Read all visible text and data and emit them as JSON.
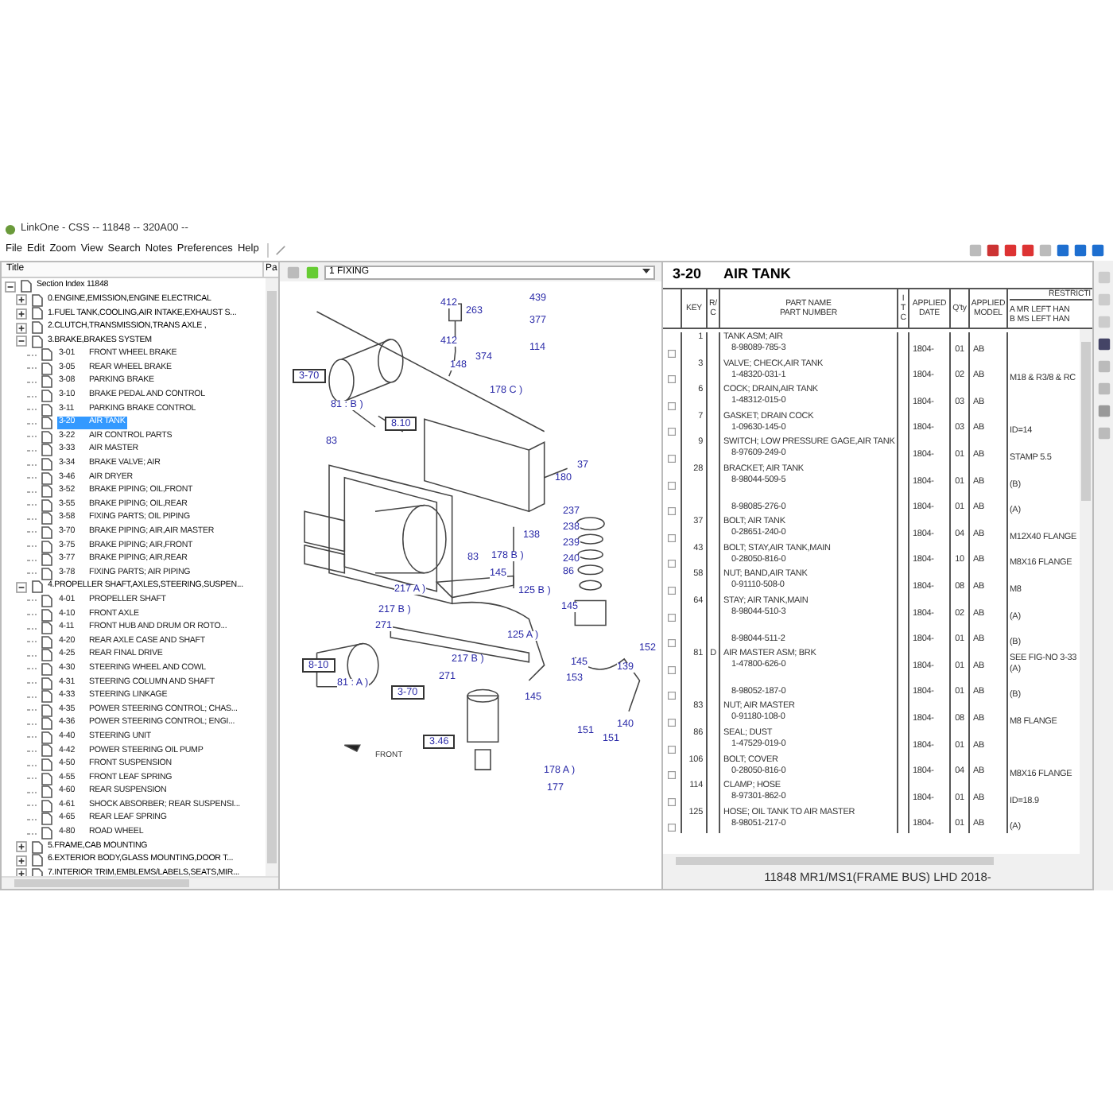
{
  "window": {
    "title": "LinkOne - CSS -- 11848 -- 320A00 --"
  },
  "menu": [
    "File",
    "Edit",
    "Zoom",
    "View",
    "Search",
    "Notes",
    "Preferences",
    "Help"
  ],
  "tree": {
    "columns": [
      "Title",
      "Pa"
    ],
    "items": [
      {
        "kind": "group",
        "label": "Section Index 11848",
        "expanded": true,
        "children": [
          {
            "kind": "group",
            "label": "0.ENGINE,EMISSION,ENGINE ELECTRICAL",
            "expanded": false
          },
          {
            "kind": "group",
            "label": "1.FUEL TANK,COOLING,AIR INTAKE,EXHAUST S...",
            "expanded": false
          },
          {
            "kind": "group",
            "label": "2.CLUTCH,TRANSMISSION,TRANS AXLE ,",
            "expanded": false
          },
          {
            "kind": "group",
            "label": "3.BRAKE,BRAKES SYSTEM",
            "expanded": true,
            "children": [
              {
                "kind": "page",
                "code": "3-01",
                "label": "FRONT WHEEL BRAKE",
                "selected": false
              },
              {
                "kind": "page",
                "code": "3-05",
                "label": "REAR WHEEL BRAKE",
                "selected": false
              },
              {
                "kind": "page",
                "code": "3-08",
                "label": "PARKING BRAKE",
                "selected": false
              },
              {
                "kind": "page",
                "code": "3-10",
                "label": "BRAKE PEDAL AND CONTROL",
                "selected": false
              },
              {
                "kind": "page",
                "code": "3-11",
                "label": "PARKING BRAKE CONTROL",
                "selected": false
              },
              {
                "kind": "page",
                "code": "3-20",
                "label": "AIR TANK",
                "selected": true
              },
              {
                "kind": "page",
                "code": "3-22",
                "label": "AIR CONTROL PARTS",
                "selected": false
              },
              {
                "kind": "page",
                "code": "3-33",
                "label": "AIR MASTER",
                "selected": false
              },
              {
                "kind": "page",
                "code": "3-34",
                "label": "BRAKE VALVE; AIR",
                "selected": false
              },
              {
                "kind": "page",
                "code": "3-46",
                "label": "AIR DRYER",
                "selected": false
              },
              {
                "kind": "page",
                "code": "3-52",
                "label": "BRAKE PIPING; OIL,FRONT",
                "selected": false
              },
              {
                "kind": "page",
                "code": "3-55",
                "label": "BRAKE PIPING; OIL,REAR",
                "selected": false
              },
              {
                "kind": "page",
                "code": "3-58",
                "label": "FIXING PARTS; OIL PIPING",
                "selected": false
              },
              {
                "kind": "page",
                "code": "3-70",
                "label": "BRAKE PIPING; AIR,AIR MASTER",
                "selected": false
              },
              {
                "kind": "page",
                "code": "3-75",
                "label": "BRAKE PIPING; AIR,FRONT",
                "selected": false
              },
              {
                "kind": "page",
                "code": "3-77",
                "label": "BRAKE PIPING; AIR,REAR",
                "selected": false
              },
              {
                "kind": "page",
                "code": "3-78",
                "label": "FIXING PARTS; AIR PIPING",
                "selected": false
              }
            ]
          },
          {
            "kind": "group",
            "label": "4.PROPELLER SHAFT,AXLES,STEERING,SUSPEN...",
            "expanded": true,
            "children": [
              {
                "kind": "page",
                "code": "4-01",
                "label": "PROPELLER SHAFT",
                "selected": false
              },
              {
                "kind": "page",
                "code": "4-10",
                "label": "FRONT AXLE",
                "selected": false
              },
              {
                "kind": "page",
                "code": "4-11",
                "label": "FRONT HUB AND DRUM OR ROTO...",
                "selected": false
              },
              {
                "kind": "page",
                "code": "4-20",
                "label": "REAR AXLE CASE AND SHAFT",
                "selected": false
              },
              {
                "kind": "page",
                "code": "4-25",
                "label": "REAR FINAL DRIVE",
                "selected": false
              },
              {
                "kind": "page",
                "code": "4-30",
                "label": "STEERING WHEEL AND COWL",
                "selected": false
              },
              {
                "kind": "page",
                "code": "4-31",
                "label": "STEERING COLUMN AND SHAFT",
                "selected": false
              },
              {
                "kind": "page",
                "code": "4-33",
                "label": "STEERING LINKAGE",
                "selected": false
              },
              {
                "kind": "page",
                "code": "4-35",
                "label": "POWER STEERING CONTROL; CHAS...",
                "selected": false
              },
              {
                "kind": "page",
                "code": "4-36",
                "label": "POWER STEERING CONTROL; ENGI...",
                "selected": false
              },
              {
                "kind": "page",
                "code": "4-40",
                "label": "STEERING UNIT",
                "selected": false
              },
              {
                "kind": "page",
                "code": "4-42",
                "label": "POWER STEERING OIL PUMP",
                "selected": false
              },
              {
                "kind": "page",
                "code": "4-50",
                "label": "FRONT SUSPENSION",
                "selected": false
              },
              {
                "kind": "page",
                "code": "4-55",
                "label": "FRONT LEAF SPRING",
                "selected": false
              },
              {
                "kind": "page",
                "code": "4-60",
                "label": "REAR SUSPENSION",
                "selected": false
              },
              {
                "kind": "page",
                "code": "4-61",
                "label": "SHOCK ABSORBER; REAR SUSPENSI...",
                "selected": false
              },
              {
                "kind": "page",
                "code": "4-65",
                "label": "REAR LEAF SPRING",
                "selected": false
              },
              {
                "kind": "page",
                "code": "4-80",
                "label": "ROAD WHEEL",
                "selected": false
              }
            ]
          },
          {
            "kind": "group",
            "label": "5.FRAME,CAB MOUNTING",
            "expanded": false
          },
          {
            "kind": "group",
            "label": "6.EXTERIOR BODY,GLASS MOUNTING,DOOR T...",
            "expanded": false
          },
          {
            "kind": "group",
            "label": "7.INTERIOR TRIM,EMBLEMS/LABELS,SEATS,MIR...",
            "expanded": false
          }
        ]
      }
    ]
  },
  "diagram": {
    "selector": "1 FIXING",
    "callouts": [
      {
        "kind": "num",
        "text": "412"
      },
      {
        "kind": "num",
        "text": "263"
      },
      {
        "kind": "num",
        "text": "439"
      },
      {
        "kind": "num",
        "text": "377"
      },
      {
        "kind": "num",
        "text": "412"
      },
      {
        "kind": "num",
        "text": "374"
      },
      {
        "kind": "num",
        "text": "114"
      },
      {
        "kind": "num",
        "text": "148"
      },
      {
        "kind": "num",
        "text": "178 C )"
      },
      {
        "kind": "ref",
        "text": "3-70"
      },
      {
        "kind": "num",
        "text": "81 : B )"
      },
      {
        "kind": "ref",
        "text": "8.10"
      },
      {
        "kind": "num",
        "text": "83"
      },
      {
        "kind": "num",
        "text": "180"
      },
      {
        "kind": "num",
        "text": "37"
      },
      {
        "kind": "num",
        "text": "237"
      },
      {
        "kind": "num",
        "text": "238"
      },
      {
        "kind": "num",
        "text": "138"
      },
      {
        "kind": "num",
        "text": "239"
      },
      {
        "kind": "num",
        "text": "240"
      },
      {
        "kind": "num",
        "text": "86"
      },
      {
        "kind": "num",
        "text": "83"
      },
      {
        "kind": "num",
        "text": "178 B )"
      },
      {
        "kind": "num",
        "text": "145"
      },
      {
        "kind": "num",
        "text": "217 A )"
      },
      {
        "kind": "num",
        "text": "125 B )"
      },
      {
        "kind": "num",
        "text": "217 B )"
      },
      {
        "kind": "num",
        "text": "145"
      },
      {
        "kind": "num",
        "text": "271"
      },
      {
        "kind": "num",
        "text": "125 A )"
      },
      {
        "kind": "num",
        "text": "145"
      },
      {
        "kind": "num",
        "text": "152"
      },
      {
        "kind": "ref",
        "text": "8-10"
      },
      {
        "kind": "num",
        "text": "217 B )"
      },
      {
        "kind": "num",
        "text": "271"
      },
      {
        "kind": "num",
        "text": "153"
      },
      {
        "kind": "num",
        "text": "139"
      },
      {
        "kind": "num",
        "text": "81 : A )"
      },
      {
        "kind": "ref",
        "text": "3-70"
      },
      {
        "kind": "num",
        "text": "145"
      },
      {
        "kind": "num",
        "text": "140"
      },
      {
        "kind": "num",
        "text": "151"
      },
      {
        "kind": "num",
        "text": "151"
      },
      {
        "kind": "ref",
        "text": "3.46"
      },
      {
        "kind": "note",
        "text": "FRONT"
      },
      {
        "kind": "num",
        "text": "178 A )"
      },
      {
        "kind": "num",
        "text": "177"
      }
    ]
  },
  "parts": {
    "code": "3-20",
    "title": "AIR TANK",
    "header": {
      "key": "KEY",
      "rc": "R/C",
      "part": [
        "PART NAME",
        "PART NUMBER"
      ],
      "itc": "ITC",
      "date": [
        "APPLIED",
        "DATE"
      ],
      "qty": "Q'ty",
      "model": [
        "APPLIED",
        "MODEL"
      ],
      "restriction": "RESTRICTI",
      "restriction_lines": [
        "A MR LEFT HAN",
        "B MS LEFT HAN"
      ]
    },
    "rows": [
      {
        "checked": false,
        "key": "1",
        "name": "TANK ASM; AIR",
        "number": "8-98089-785-3",
        "date": "1804-",
        "qty": "01",
        "model": "AB"
      },
      {
        "checked": false,
        "key": "3",
        "name": "VALVE; CHECK,AIR TANK",
        "number": "1-48320-031-1",
        "date": "1804-",
        "qty": "02",
        "model": "AB",
        "restriction": [
          "M18 & R3/8 & RC"
        ]
      },
      {
        "checked": false,
        "key": "6",
        "name": "COCK; DRAIN,AIR TANK",
        "number": "1-48312-015-0",
        "date": "1804-",
        "qty": "03",
        "model": "AB"
      },
      {
        "checked": false,
        "key": "7",
        "name": "GASKET; DRAIN COCK",
        "number": "1-09630-145-0",
        "date": "1804-",
        "qty": "03",
        "model": "AB",
        "restriction": [
          "ID=14"
        ]
      },
      {
        "checked": false,
        "key": "9",
        "name": "SWITCH; LOW PRESSURE GAGE,AIR TANK",
        "number": "8-97609-249-0",
        "date": "1804-",
        "qty": "01",
        "model": "AB",
        "restriction": [
          "STAMP 5.5"
        ]
      },
      {
        "checked": false,
        "key": "28",
        "name": "BRACKET; AIR TANK",
        "number": "8-98044-509-5",
        "date": "1804-",
        "qty": "01",
        "model": "AB",
        "restriction": [
          "(B)"
        ]
      },
      {
        "checked": false,
        "number": "8-98085-276-0",
        "date": "1804-",
        "qty": "01",
        "model": "AB",
        "restriction": [
          "(A)"
        ]
      },
      {
        "checked": false,
        "key": "37",
        "name": "BOLT; AIR TANK",
        "number": "0-28651-240-0",
        "date": "1804-",
        "qty": "04",
        "model": "AB",
        "restriction": [
          "M12X40 FLANGE"
        ]
      },
      {
        "checked": false,
        "key": "43",
        "name": "BOLT; STAY,AIR TANK,MAIN",
        "number": "0-28050-816-0",
        "date": "1804-",
        "qty": "10",
        "model": "AB",
        "restriction": [
          "M8X16 FLANGE"
        ]
      },
      {
        "checked": false,
        "key": "58",
        "name": "NUT; BAND,AIR TANK",
        "number": "0-91110-508-0",
        "date": "1804-",
        "qty": "08",
        "model": "AB",
        "restriction": [
          "M8"
        ]
      },
      {
        "checked": false,
        "key": "64",
        "name": "STAY; AIR TANK,MAIN",
        "number": "8-98044-510-3",
        "date": "1804-",
        "qty": "02",
        "model": "AB",
        "restriction": [
          "(A)"
        ]
      },
      {
        "checked": false,
        "number": "8-98044-511-2",
        "date": "1804-",
        "qty": "01",
        "model": "AB",
        "restriction": [
          "(B)"
        ]
      },
      {
        "checked": false,
        "key": "81",
        "rc": "D",
        "name": "AIR MASTER ASM; BRK",
        "number": "1-47800-626-0",
        "date": "1804-",
        "qty": "01",
        "model": "AB",
        "restriction": [
          "SEE FIG-NO 3-33",
          "(A)"
        ]
      },
      {
        "checked": false,
        "number": "8-98052-187-0",
        "date": "1804-",
        "qty": "01",
        "model": "AB",
        "restriction": [
          "(B)"
        ]
      },
      {
        "checked": false,
        "key": "83",
        "name": "NUT; AIR MASTER",
        "number": "0-91180-108-0",
        "date": "1804-",
        "qty": "08",
        "model": "AB",
        "restriction": [
          "M8 FLANGE"
        ]
      },
      {
        "checked": false,
        "key": "86",
        "name": "SEAL; DUST",
        "number": "1-47529-019-0",
        "date": "1804-",
        "qty": "01",
        "model": "AB"
      },
      {
        "checked": false,
        "key": "106",
        "name": "BOLT; COVER",
        "number": "0-28050-816-0",
        "date": "1804-",
        "qty": "04",
        "model": "AB",
        "restriction": [
          "M8X16 FLANGE"
        ]
      },
      {
        "checked": false,
        "key": "114",
        "name": "CLAMP; HOSE",
        "number": "8-97301-862-0",
        "date": "1804-",
        "qty": "01",
        "model": "AB",
        "restriction": [
          "ID=18.9"
        ]
      },
      {
        "checked": false,
        "key": "125",
        "name": "HOSE; OIL TANK TO AIR MASTER",
        "number": "8-98051-217-0",
        "date": "1804-",
        "qty": "01",
        "model": "AB",
        "restriction": [
          "(A)"
        ]
      }
    ],
    "status": "11848 MR1/MS1(FRAME BUS) LHD 2018-"
  }
}
